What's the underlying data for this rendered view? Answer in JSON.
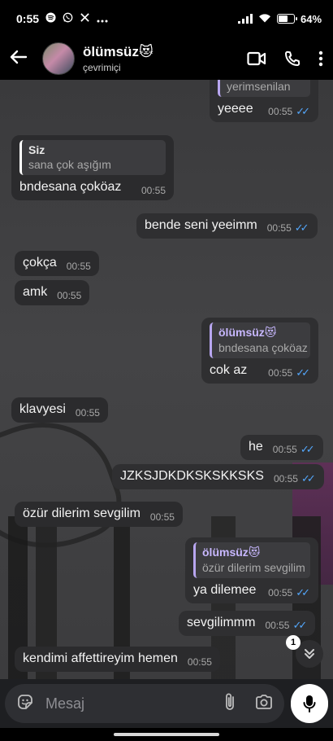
{
  "status_bar": {
    "time": "0:55",
    "notification_icons": [
      "spotify-icon",
      "whatsapp-icon",
      "x-icon",
      "more-icon"
    ],
    "battery": "64"
  },
  "header": {
    "contact_name": "ölümsüz😻",
    "contact_status": "çevrimiçi"
  },
  "messages": [
    {
      "dir": "out",
      "quote_text": "yerimsenilan",
      "text": "yeeee",
      "time": "00:55",
      "read": true
    },
    {
      "dir": "in",
      "quote_name": "Siz",
      "quote_text": "sana çok aşığım",
      "text": "bndesana çoköaz",
      "time": "00:55"
    },
    {
      "dir": "out",
      "text": "bende seni yeeimm",
      "time": "00:55",
      "read": true
    },
    {
      "dir": "in",
      "text": "çokça",
      "time": "00:55"
    },
    {
      "dir": "in",
      "text": "amk",
      "time": "00:55"
    },
    {
      "dir": "out",
      "quote_name": "ölümsüz😻",
      "quote_text": "bndesana çoköaz",
      "text": "cok az",
      "time": "00:55",
      "read": true
    },
    {
      "dir": "in",
      "text": "klavyesi",
      "time": "00:55"
    },
    {
      "dir": "out",
      "text": "he",
      "time": "00:55",
      "read": true
    },
    {
      "dir": "out",
      "text": "JZKSJDKDKSKSKKSKS",
      "time": "00:55",
      "read": true
    },
    {
      "dir": "in",
      "text": "özür dilerim sevgilim",
      "time": "00:55"
    },
    {
      "dir": "out",
      "quote_name": "ölümsüz😻",
      "quote_text": "özür dilerim sevgilim",
      "text": "ya dilemee",
      "time": "00:55",
      "read": true
    },
    {
      "dir": "out",
      "text": "sevgilimmm",
      "time": "00:55",
      "read": true
    },
    {
      "dir": "in",
      "text": "kendimi affettireyim hemen",
      "time": "00:55"
    }
  ],
  "unread_count": "1",
  "input": {
    "placeholder": "Mesaj"
  },
  "colors": {
    "accent_tick": "#53a6fa",
    "quote_bar": "#b8a6f0"
  }
}
